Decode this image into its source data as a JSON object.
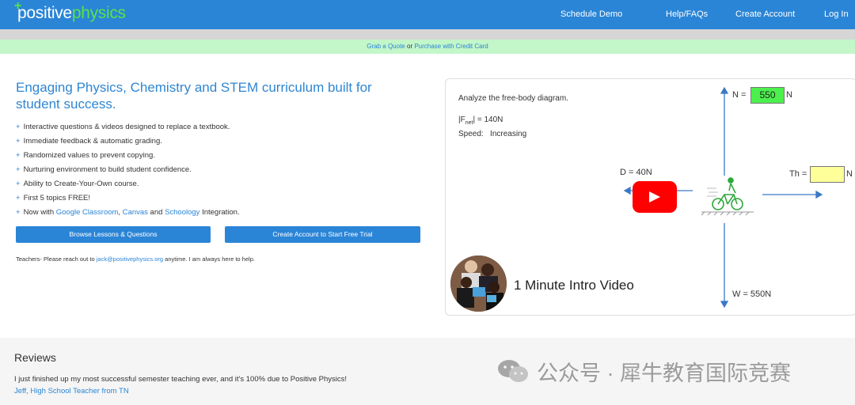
{
  "header": {
    "logo_part1": "positive",
    "logo_part2": "physics",
    "logo_plus": "+",
    "nav": [
      "Schedule Demo",
      "Help/FAQs",
      "Create Account",
      "Log In"
    ]
  },
  "promo_strip": {
    "quote_link": "Grab a Quote",
    "or": " or ",
    "purchase_link": "Purchase with Credit Card"
  },
  "hero": {
    "title": "Engaging Physics, Chemistry and STEM curriculum built for student success.",
    "bullet": "+",
    "features": [
      "Interactive questions & videos designed to replace a textbook.",
      "Immediate feedback & automatic grading.",
      "Randomized values to prevent copying.",
      "Nurturing environment to build student confidence.",
      "Ability to Create-Your-Own course.",
      "First 5 topics FREE!"
    ],
    "integration": {
      "prefix": "Now with ",
      "google": "Google Classroom",
      "sep1": ", ",
      "canvas": "Canvas",
      "sep2": " and ",
      "schoology": "Schoology",
      "suffix": " Integration."
    },
    "browse_button": "Browse Lessons & Questions",
    "create_button": "Create Account to Start Free Trial",
    "teachers_prefix": "Teachers- Please reach out to ",
    "teachers_email": "jack@positivephysics.org",
    "teachers_suffix": " anytime. I am always here to help."
  },
  "video": {
    "prompt": "Analyze the free-body diagram.",
    "fnet_label": "|F",
    "fnet_sub": "net",
    "fnet_value": "| = 140N",
    "speed_label": "Speed:",
    "speed_value": "Increasing",
    "n_label": "N =",
    "n_value": "550",
    "n_unit": "N",
    "d_label": "D = 40N",
    "th_label": "Th =",
    "th_value": "",
    "th_unit": "N",
    "w_label": "W = 550N",
    "intro_title": "1 Minute Intro Video"
  },
  "reviews": {
    "title": "Reviews",
    "text": "I just finished up my most successful semester teaching ever, and it's 100% due to Positive Physics!",
    "author": "Jeff, High School Teacher from TN"
  },
  "watermark": {
    "text": "公众号 · 犀牛教育国际竞赛"
  },
  "colors": {
    "brand_blue": "#2a85d6",
    "brand_green": "#57e34a",
    "promo_bg": "#c3f6c9",
    "n_box": "#4cf04c",
    "th_box": "#ffff99",
    "youtube_red": "#ff0000"
  }
}
